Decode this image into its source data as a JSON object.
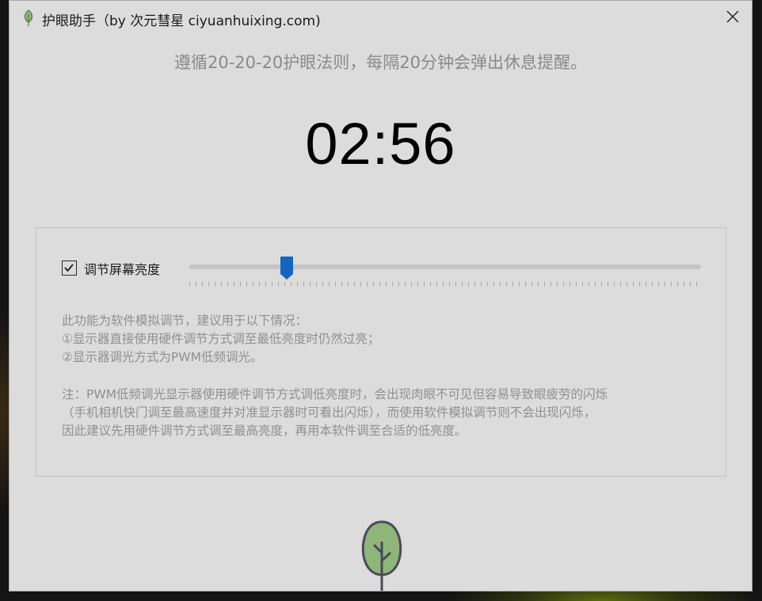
{
  "window": {
    "title": "护眼助手（by 次元彗星 ciyuanhuixing.com)",
    "title_icon": "leaf-icon",
    "close_icon": "close-icon"
  },
  "main": {
    "headline": "遵循20-20-20护眼法则，每隔20分钟会弹出休息提醒。",
    "timer": "02:56"
  },
  "brightness": {
    "checkbox_checked": true,
    "checkbox_label": "调节屏幕亮度",
    "slider_value": 0.19,
    "accent_color": "#1565c0"
  },
  "description": {
    "lines": [
      "此功能为软件模拟调节，建议用于以下情况：",
      "①显示器直接使用硬件调节方式调至最低亮度时仍然过亮；",
      "②显示器调光方式为PWM低频调光。"
    ],
    "note_lines": [
      "注：PWM低频调光显示器使用硬件调节方式调低亮度时，会出现肉眼不可见但容易导致眼疲劳的闪烁",
      "（手机相机快门调至最高速度并对准显示器时可看出闪烁），而使用软件模拟调节则不会出现闪烁，",
      "因此建议先用硬件调节方式调至最高亮度，再用本软件调至合适的低亮度。"
    ]
  },
  "decor": {
    "tree_icon": "tree-icon",
    "tree_color": "#8fb57a"
  }
}
